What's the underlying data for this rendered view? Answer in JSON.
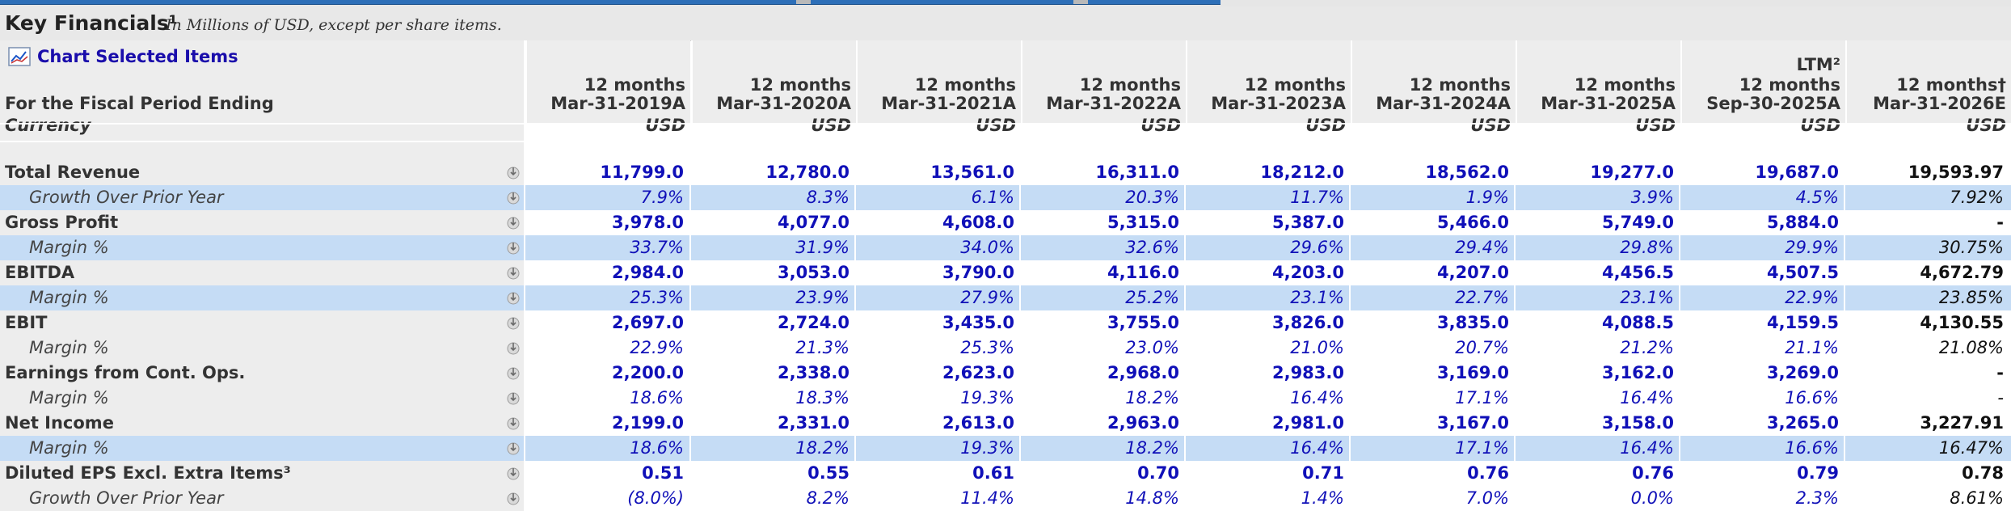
{
  "title": {
    "main": "Key Financials¹",
    "note": "In Millions of USD, except per share items."
  },
  "chart_link": {
    "label": "Chart Selected Items",
    "icon": "chart-icon"
  },
  "header": {
    "period_label": "For the Fiscal Period Ending",
    "currency_label": "Currency",
    "columns": [
      {
        "l1": "",
        "l2": "12 months",
        "l3": "Mar-31-2019A",
        "currency": "USD"
      },
      {
        "l1": "",
        "l2": "12 months",
        "l3": "Mar-31-2020A",
        "currency": "USD"
      },
      {
        "l1": "",
        "l2": "12 months",
        "l3": "Mar-31-2021A",
        "currency": "USD"
      },
      {
        "l1": "",
        "l2": "12 months",
        "l3": "Mar-31-2022A",
        "currency": "USD"
      },
      {
        "l1": "",
        "l2": "12 months",
        "l3": "Mar-31-2023A",
        "currency": "USD"
      },
      {
        "l1": "",
        "l2": "12 months",
        "l3": "Mar-31-2024A",
        "currency": "USD"
      },
      {
        "l1": "",
        "l2": "12 months",
        "l3": "Mar-31-2025A",
        "currency": "USD"
      },
      {
        "l1": "LTM²",
        "l2": "12 months",
        "l3": "Sep-30-2025A",
        "currency": "USD"
      },
      {
        "l1": "",
        "l2": "12 months†",
        "l3": "Mar-31-2026E",
        "currency": "USD"
      }
    ]
  },
  "rows": [
    {
      "label": "Total Revenue",
      "values": [
        "11,799.0",
        "12,780.0",
        "13,561.0",
        "16,311.0",
        "18,212.0",
        "18,562.0",
        "19,277.0",
        "19,687.0",
        "19,593.97"
      ]
    },
    {
      "label": "Growth Over Prior Year",
      "values": [
        "7.9%",
        "8.3%",
        "6.1%",
        "20.3%",
        "11.7%",
        "1.9%",
        "3.9%",
        "4.5%",
        "7.92%"
      ]
    },
    {
      "label": "Gross Profit",
      "values": [
        "3,978.0",
        "4,077.0",
        "4,608.0",
        "5,315.0",
        "5,387.0",
        "5,466.0",
        "5,749.0",
        "5,884.0",
        "-"
      ]
    },
    {
      "label": "Margin %",
      "values": [
        "33.7%",
        "31.9%",
        "34.0%",
        "32.6%",
        "29.6%",
        "29.4%",
        "29.8%",
        "29.9%",
        "30.75%"
      ]
    },
    {
      "label": "EBITDA",
      "values": [
        "2,984.0",
        "3,053.0",
        "3,790.0",
        "4,116.0",
        "4,203.0",
        "4,207.0",
        "4,456.5",
        "4,507.5",
        "4,672.79"
      ]
    },
    {
      "label": "Margin %",
      "values": [
        "25.3%",
        "23.9%",
        "27.9%",
        "25.2%",
        "23.1%",
        "22.7%",
        "23.1%",
        "22.9%",
        "23.85%"
      ]
    },
    {
      "label": "EBIT",
      "values": [
        "2,697.0",
        "2,724.0",
        "3,435.0",
        "3,755.0",
        "3,826.0",
        "3,835.0",
        "4,088.5",
        "4,159.5",
        "4,130.55"
      ]
    },
    {
      "label": "Margin %",
      "values": [
        "22.9%",
        "21.3%",
        "25.3%",
        "23.0%",
        "21.0%",
        "20.7%",
        "21.2%",
        "21.1%",
        "21.08%"
      ]
    },
    {
      "label": "Earnings from Cont. Ops.",
      "values": [
        "2,200.0",
        "2,338.0",
        "2,623.0",
        "2,968.0",
        "2,983.0",
        "3,169.0",
        "3,162.0",
        "3,269.0",
        "-"
      ]
    },
    {
      "label": "Margin %",
      "values": [
        "18.6%",
        "18.3%",
        "19.3%",
        "18.2%",
        "16.4%",
        "17.1%",
        "16.4%",
        "16.6%",
        "-"
      ]
    },
    {
      "label": "Net Income",
      "values": [
        "2,199.0",
        "2,331.0",
        "2,613.0",
        "2,963.0",
        "2,981.0",
        "3,167.0",
        "3,158.0",
        "3,265.0",
        "3,227.91"
      ]
    },
    {
      "label": "Margin %",
      "values": [
        "18.6%",
        "18.2%",
        "19.3%",
        "18.2%",
        "16.4%",
        "17.1%",
        "16.4%",
        "16.6%",
        "16.47%"
      ]
    },
    {
      "label": "Diluted EPS Excl. Extra Items³",
      "values": [
        "0.51",
        "0.55",
        "0.61",
        "0.70",
        "0.71",
        "0.76",
        "0.76",
        "0.79",
        "0.78"
      ]
    },
    {
      "label": "Growth Over Prior Year",
      "values": [
        "(8.0%)",
        "8.2%",
        "11.4%",
        "14.8%",
        "1.4%",
        "7.0%",
        "0.0%",
        "2.3%",
        "8.61%"
      ]
    }
  ],
  "colors": {
    "value_blue": "#1010b8",
    "highlight": "#c5dcf5",
    "header_gray": "#ededed"
  },
  "row_icon": "chart-add-icon"
}
